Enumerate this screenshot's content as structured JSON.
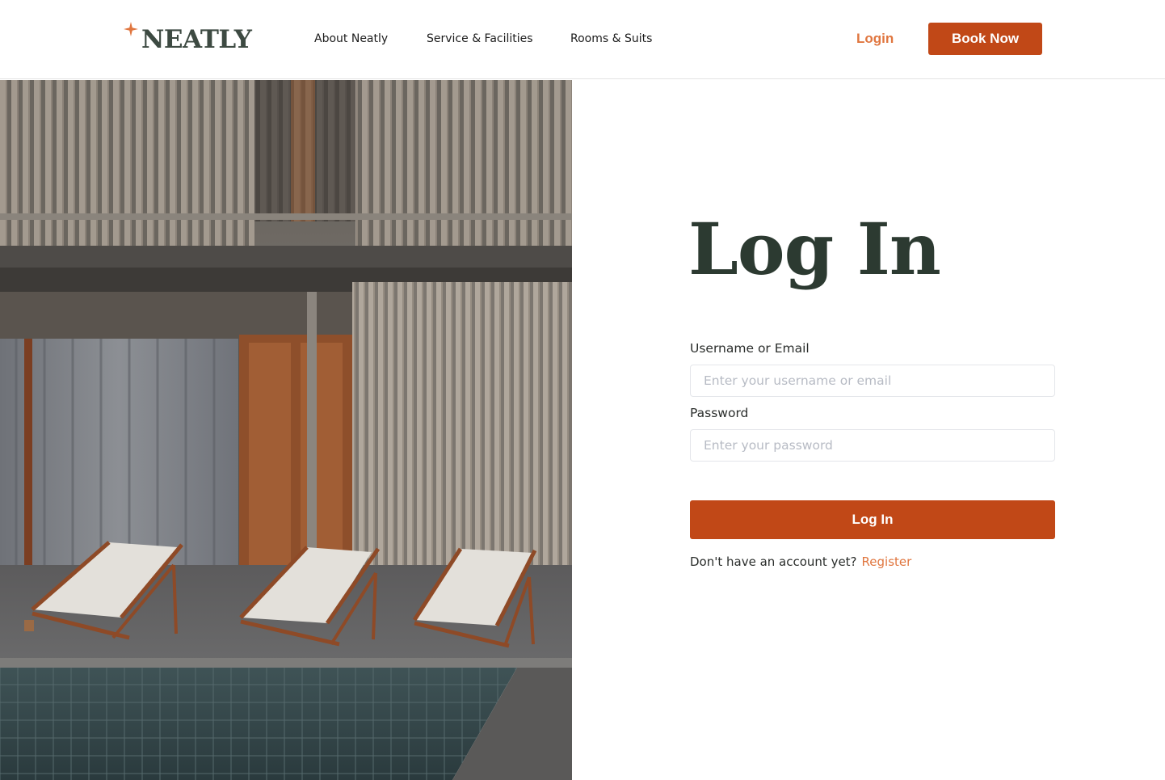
{
  "brand": {
    "name": "NEATLY",
    "star_color": "#e0763f",
    "text_color": "#3d4a42"
  },
  "nav": {
    "items": [
      {
        "label": "About Neatly"
      },
      {
        "label": "Service & Facilities"
      },
      {
        "label": "Rooms & Suits"
      }
    ],
    "login_label": "Login",
    "book_label": "Book Now"
  },
  "hero": {
    "description_icon": "hotel-poolside-photo"
  },
  "form": {
    "title": "Log In",
    "username_label": "Username or Email",
    "username_placeholder": "Enter your username or email",
    "username_value": "",
    "password_label": "Password",
    "password_placeholder": "Enter your password",
    "password_value": "",
    "submit_label": "Log In",
    "register_prompt": "Don't have an account yet?",
    "register_link": "Register"
  },
  "colors": {
    "accent": "#c14817",
    "accent_light": "#e0763f",
    "title": "#2c3a31"
  }
}
